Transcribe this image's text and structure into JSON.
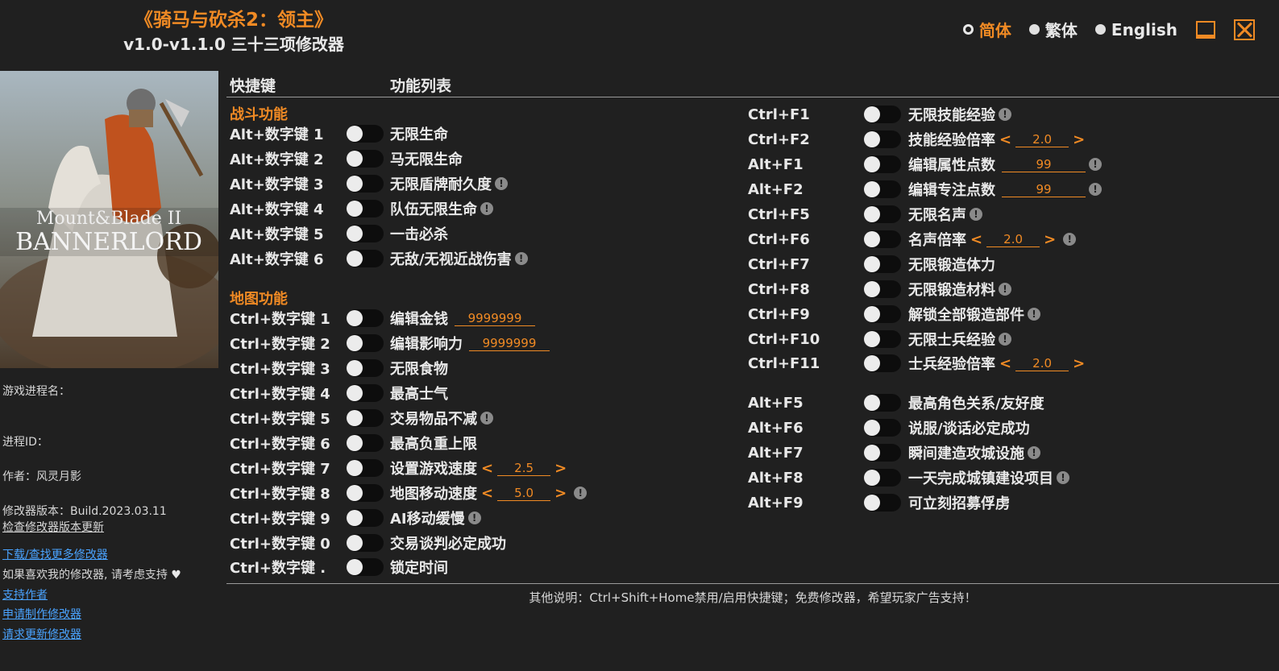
{
  "header": {
    "title": "《骑马与砍杀2：领主》",
    "subtitle": "v1.0-v1.1.0 三十三项修改器",
    "languages": [
      {
        "label": "简体",
        "active": true
      },
      {
        "label": "繁体",
        "active": false
      },
      {
        "label": "English",
        "active": false
      }
    ]
  },
  "cover": {
    "line1": "Mount&Blade II",
    "line2": "BANNERLORD"
  },
  "sidebar": {
    "process_name_label": "游戏进程名：",
    "process_id_label": "进程ID：",
    "author": "作者：风灵月影",
    "version": "修改器版本：Build.2023.03.11",
    "check_update": "检查修改器版本更新",
    "download_more": "下载/查找更多修改器",
    "support_text": "如果喜欢我的修改器, 请考虑支持",
    "support_author": "支持作者",
    "request_make": "申请制作修改器",
    "request_update": "请求更新修改器"
  },
  "columns": {
    "hotkey": "快捷键",
    "features": "功能列表"
  },
  "sections": {
    "combat": "战斗功能",
    "map": "地图功能"
  },
  "left_items": [
    {
      "key": "Alt+数字键 1",
      "label": "无限生命"
    },
    {
      "key": "Alt+数字键 2",
      "label": "马无限生命"
    },
    {
      "key": "Alt+数字键 3",
      "label": "无限盾牌耐久度",
      "info": "!"
    },
    {
      "key": "Alt+数字键 4",
      "label": "队伍无限生命",
      "info": "!"
    },
    {
      "key": "Alt+数字键 5",
      "label": "一击必杀"
    },
    {
      "key": "Alt+数字键 6",
      "label": "无敌/无视近战伤害",
      "info": "!"
    },
    {
      "key": "Ctrl+数字键 1",
      "label": "编辑金钱",
      "value": "9999999"
    },
    {
      "key": "Ctrl+数字键 2",
      "label": "编辑影响力",
      "value": "9999999"
    },
    {
      "key": "Ctrl+数字键 3",
      "label": "无限食物"
    },
    {
      "key": "Ctrl+数字键 4",
      "label": "最高士气"
    },
    {
      "key": "Ctrl+数字键 5",
      "label": "交易物品不减",
      "info": "!"
    },
    {
      "key": "Ctrl+数字键 6",
      "label": "最高负重上限"
    },
    {
      "key": "Ctrl+数字键 7",
      "label": "设置游戏速度",
      "value": "2.5",
      "arrow_left": "<",
      "arrow_right": ">"
    },
    {
      "key": "Ctrl+数字键 8",
      "label": "地图移动速度",
      "value": "5.0",
      "arrow_left": "<",
      "arrow_right": ">",
      "info": "!"
    },
    {
      "key": "Ctrl+数字键 9",
      "label": "AI移动缓慢",
      "info": "!"
    },
    {
      "key": "Ctrl+数字键 0",
      "label": "交易谈判必定成功"
    },
    {
      "key": "Ctrl+数字键 .",
      "label": "锁定时间"
    }
  ],
  "right_items": [
    {
      "key": "Ctrl+F1",
      "label": "无限技能经验",
      "info": "!"
    },
    {
      "key": "Ctrl+F2",
      "label": "技能经验倍率",
      "value": "2.0",
      "arrow_left": "<",
      "arrow_right": ">"
    },
    {
      "key": "Alt+F1",
      "label": "编辑属性点数",
      "value": "99",
      "info": "!"
    },
    {
      "key": "Alt+F2",
      "label": "编辑专注点数",
      "value": "99",
      "info": "!"
    },
    {
      "key": "Ctrl+F5",
      "label": "无限名声",
      "info": "!"
    },
    {
      "key": "Ctrl+F6",
      "label": "名声倍率",
      "value": "2.0",
      "arrow_left": "<",
      "arrow_right": ">",
      "info": "!"
    },
    {
      "key": "Ctrl+F7",
      "label": "无限锻造体力"
    },
    {
      "key": "Ctrl+F8",
      "label": "无限锻造材料",
      "info": "!"
    },
    {
      "key": "Ctrl+F9",
      "label": "解锁全部锻造部件",
      "info": "!"
    },
    {
      "key": "Ctrl+F10",
      "label": "无限士兵经验",
      "info": "!"
    },
    {
      "key": "Ctrl+F11",
      "label": "士兵经验倍率",
      "value": "2.0",
      "arrow_left": "<",
      "arrow_right": ">"
    },
    {
      "key": "Alt+F5",
      "label": "最高角色关系/友好度"
    },
    {
      "key": "Alt+F6",
      "label": "说服/谈话必定成功"
    },
    {
      "key": "Alt+F7",
      "label": "瞬间建造攻城设施",
      "info": "!"
    },
    {
      "key": "Alt+F8",
      "label": "一天完成城镇建设项目",
      "info": "!"
    },
    {
      "key": "Alt+F9",
      "label": "可立刻招募俘虏"
    }
  ],
  "footer": {
    "note": "其他说明：Ctrl+Shift+Home禁用/启用快捷键；免费修改器，希望玩家广告支持！"
  },
  "colors": {
    "accent": "#f08a24",
    "background": "#202020",
    "link": "#4aa3ff"
  }
}
